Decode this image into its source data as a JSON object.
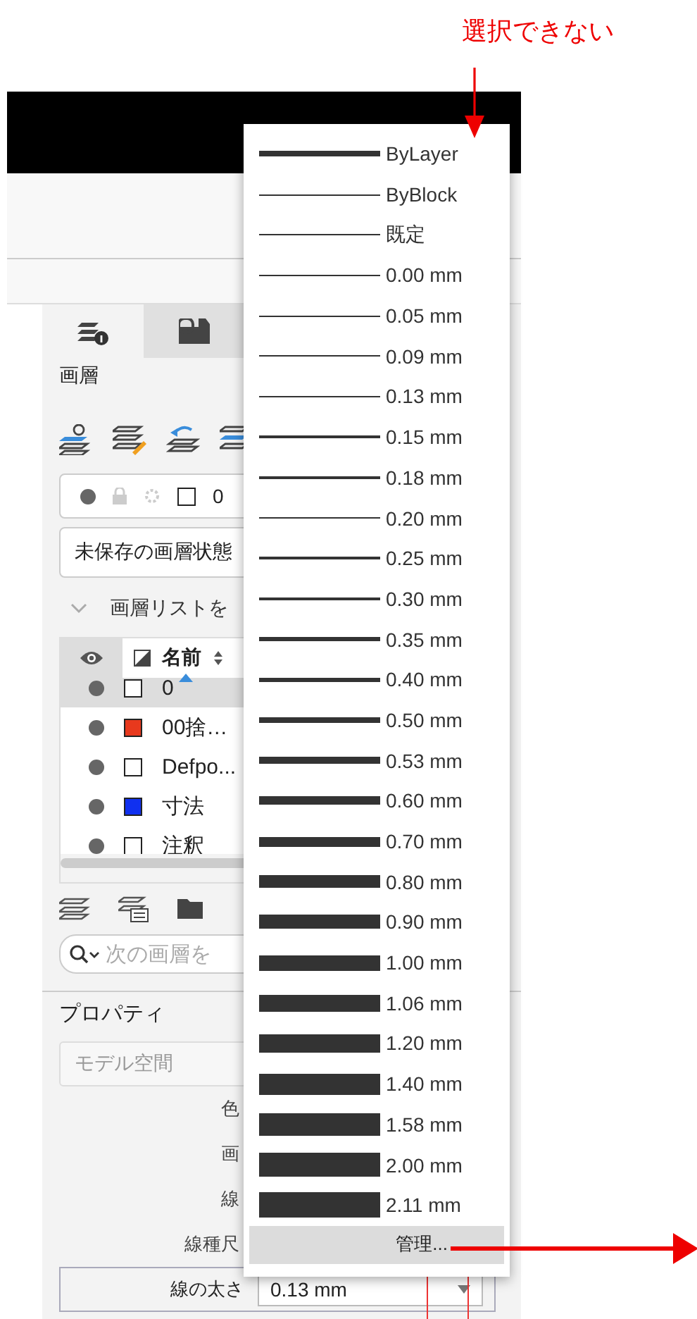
{
  "annotation": {
    "text": "選択できない"
  },
  "tabs": [
    {
      "label": "画層",
      "selected": true
    },
    {
      "selected": false
    }
  ],
  "current_layer": {
    "name": "0"
  },
  "layer_state": {
    "value": "未保存の画層状態"
  },
  "list_toggle": {
    "label": "画層リストを"
  },
  "layer_table": {
    "columns": [
      "名前"
    ],
    "rows": [
      {
        "name": "0",
        "color": "#ffffff",
        "selected": true
      },
      {
        "name": "00捨…",
        "color": "#e8391d",
        "selected": false
      },
      {
        "name": "Defpo...",
        "color": "#ffffff",
        "selected": false
      },
      {
        "name": "寸法",
        "color": "#1030f0",
        "selected": false
      },
      {
        "name": "注釈",
        "color": "#ffffff",
        "selected": false
      }
    ]
  },
  "layer_search": {
    "placeholder": "次の画層を"
  },
  "properties": {
    "title": "プロパティ",
    "space": {
      "placeholder": "モデル空間"
    },
    "rows": [
      {
        "label": "色"
      },
      {
        "label": "画"
      },
      {
        "label": "線"
      },
      {
        "label": "線種尺"
      }
    ],
    "lineweight": {
      "label": "線の太さ",
      "value": "0.13 mm"
    }
  },
  "lineweight_menu": {
    "items": [
      {
        "label": "ByLayer"
      },
      {
        "label": "ByBlock"
      },
      {
        "label": "既定"
      },
      {
        "label": "0.00 mm"
      },
      {
        "label": "0.05 mm"
      },
      {
        "label": "0.09 mm"
      },
      {
        "label": "0.13 mm"
      },
      {
        "label": "0.15 mm"
      },
      {
        "label": "0.18 mm"
      },
      {
        "label": "0.20 mm"
      },
      {
        "label": "0.25 mm"
      },
      {
        "label": "0.30 mm"
      },
      {
        "label": "0.35 mm"
      },
      {
        "label": "0.40 mm"
      },
      {
        "label": "0.50 mm"
      },
      {
        "label": "0.53 mm"
      },
      {
        "label": "0.60 mm"
      },
      {
        "label": "0.70 mm"
      },
      {
        "label": "0.80 mm"
      },
      {
        "label": "0.90 mm"
      },
      {
        "label": "1.00 mm"
      },
      {
        "label": "1.06 mm"
      },
      {
        "label": "1.20 mm"
      },
      {
        "label": "1.40 mm"
      },
      {
        "label": "1.58 mm"
      },
      {
        "label": "2.00 mm"
      },
      {
        "label": "2.11 mm"
      }
    ],
    "manage": "管理..."
  }
}
